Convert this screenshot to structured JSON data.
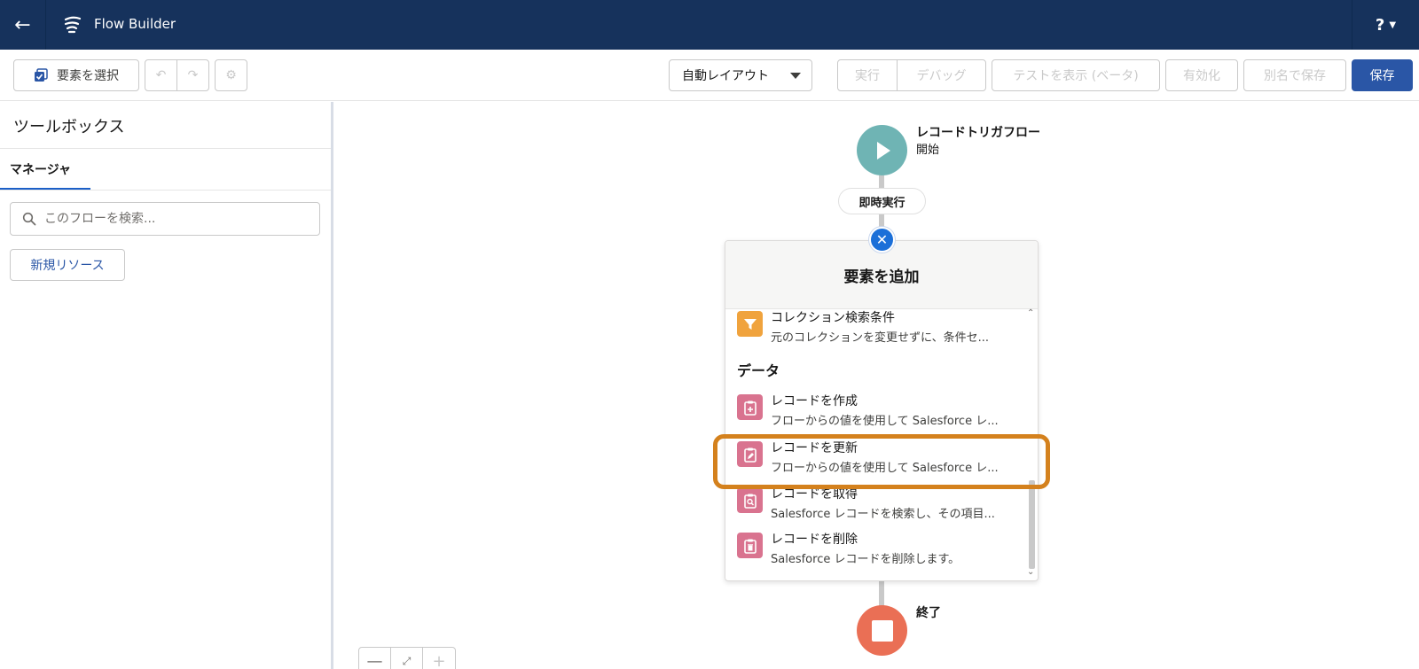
{
  "app": {
    "title": "Flow Builder",
    "help_label": "?"
  },
  "toolbar": {
    "select_label": "要素を選択",
    "layout_label": "自動レイアウト",
    "run_label": "実行",
    "debug_label": "デバッグ",
    "test_label": "テストを表示 (ベータ)",
    "activate_label": "有効化",
    "saveas_label": "別名で保存",
    "save_label": "保存"
  },
  "toolbox": {
    "title": "ツールボックス",
    "tab_label": "マネージャ",
    "search_placeholder": "このフローを検索...",
    "new_resource_label": "新規リソース"
  },
  "canvas": {
    "start": {
      "title": "レコードトリガフロー",
      "subtitle": "開始"
    },
    "path_label": "即時実行",
    "end_label": "終了",
    "add_element": {
      "title": "要素を追加",
      "section_data": "データ",
      "items": [
        {
          "name": "コレクション検索条件",
          "desc": "元のコレクションを変更せずに、条件セ...",
          "icon": "filter-icon",
          "color": "#f0a33d"
        },
        {
          "name": "レコードを作成",
          "desc": "フローからの値を使用して Salesforce レ...",
          "icon": "record-create-icon",
          "color": "#d9738f"
        },
        {
          "name": "レコードを更新",
          "desc": "フローからの値を使用して Salesforce レ...",
          "icon": "record-update-icon",
          "color": "#d9738f"
        },
        {
          "name": "レコードを取得",
          "desc": "Salesforce レコードを検索し、その項目...",
          "icon": "record-lookup-icon",
          "color": "#d9738f"
        },
        {
          "name": "レコードを削除",
          "desc": "Salesforce レコードを削除します。",
          "icon": "record-delete-icon",
          "color": "#d9738f"
        }
      ]
    }
  },
  "colors": {
    "header_bg": "#16325c",
    "brand_button": "#2a56a6",
    "start_node": "#6fb4b4",
    "end_node": "#ea6f55",
    "highlight": "#d4811d"
  }
}
